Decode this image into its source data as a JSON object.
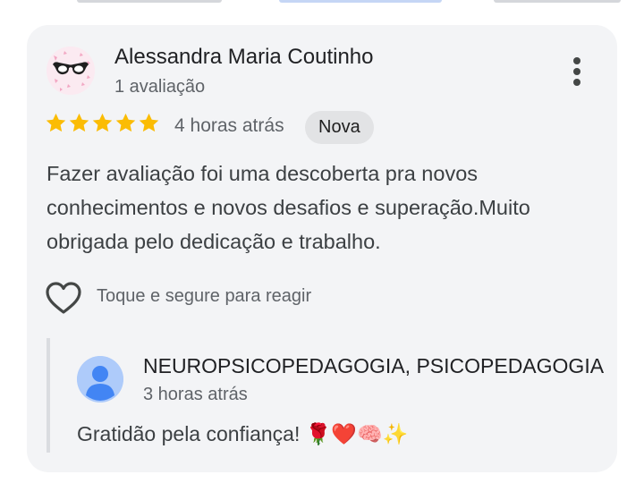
{
  "review": {
    "reviewer_name": "Alessandra Maria Coutinho",
    "review_count": "1 avaliação",
    "rating": 5,
    "rating_max": 5,
    "time": "4 horas atrás",
    "badge": "Nova",
    "text": "Fazer avaliação foi uma descoberta pra novos conhecimentos e novos desafios e superação.Muito obrigada pelo dedicação e trabalho.",
    "react_hint": "Toque e segure para reagir"
  },
  "reply": {
    "owner_name": "NEUROPSICOPEDAGOGIA, PSICOPEDAGOGIA",
    "time": "3 horas atrás",
    "text": "Gratidão pela confiança! 🌹❤️🧠✨"
  },
  "icons": {
    "more": "more-vert-icon",
    "star": "star-icon",
    "heart": "heart-outline-icon",
    "owner_avatar": "person-icon"
  },
  "colors": {
    "star": "#fbbc04",
    "card_background": "#f3f4f6",
    "badge_background": "#e2e3e5",
    "owner_avatar_background": "#aecbfa",
    "owner_avatar_figure": "#4285f4"
  }
}
